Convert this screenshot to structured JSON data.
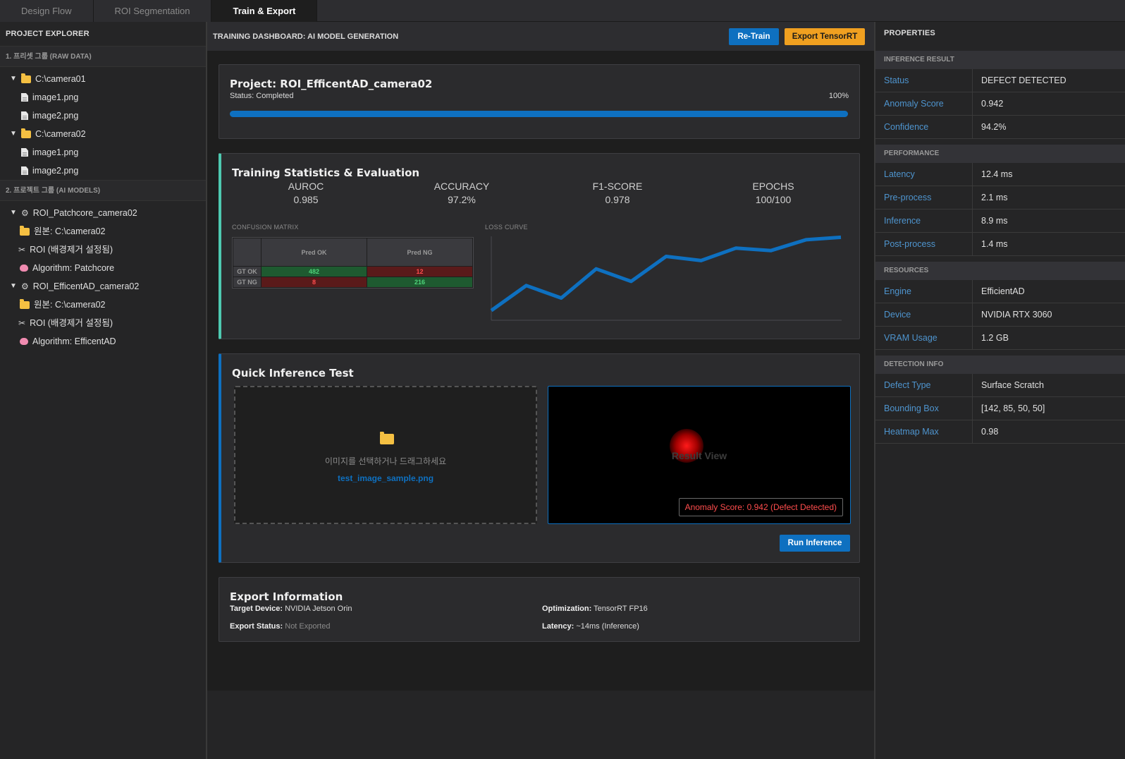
{
  "tabs": [
    {
      "label": "Design Flow"
    },
    {
      "label": "ROI Segmentation"
    },
    {
      "label": "Train & Export"
    }
  ],
  "explorer": {
    "title": "PROJECT EXPLORER",
    "group1": {
      "label": "1. 프리셋 그룹 (RAW DATA)",
      "folders": [
        {
          "name": "C:\\camera01",
          "files": [
            "image1.png",
            "image2.png"
          ]
        },
        {
          "name": "C:\\camera02",
          "files": [
            "image1.png",
            "image2.png"
          ]
        }
      ]
    },
    "group2": {
      "label": "2. 프로젝트 그룹 (AI MODELS)",
      "models": [
        {
          "name": "ROI_Patchcore_camera02",
          "source": "원본: C:\\camera02",
          "roi": "ROI (배경제거 설정됨)",
          "algorithm": "Algorithm: Patchcore"
        },
        {
          "name": "ROI_EfficentAD_camera02",
          "source": "원본: C:\\camera02",
          "roi": "ROI (배경제거 설정됨)",
          "algorithm": "Algorithm: EfficentAD"
        }
      ]
    }
  },
  "dashboard": {
    "title": "TRAINING DASHBOARD: AI MODEL GENERATION",
    "retrain_label": "Re-Train",
    "export_label": "Export TensorRT",
    "project": {
      "title": "Project: ROI_EfficentAD_camera02",
      "status": "Status: Completed",
      "progress_text": "100%",
      "progress": 1.0
    },
    "stats": {
      "title": "Training Statistics & Evaluation",
      "items": [
        {
          "label": "AUROC",
          "value": "0.985"
        },
        {
          "label": "ACCURACY",
          "value": "97.2%"
        },
        {
          "label": "F1-SCORE",
          "value": "0.978"
        },
        {
          "label": "EPOCHS",
          "value": "100/100"
        }
      ],
      "confusion_label": "CONFUSION MATRIX",
      "confusion": {
        "cols": [
          "Pred OK",
          "Pred NG"
        ],
        "rows": [
          {
            "label": "GT OK",
            "values": [
              "482",
              "12"
            ]
          },
          {
            "label": "GT NG",
            "values": [
              "8",
              "216"
            ]
          }
        ]
      },
      "loss_label": "LOSS CURVE"
    },
    "inference": {
      "title": "Quick Inference Test",
      "drop_text": "이미지를 선택하거나 드래그하세요",
      "file_name": "test_image_sample.png",
      "result_label": "Result View",
      "score_text": "Anomaly Score: 0.942 (Defect Detected)",
      "run_label": "Run Inference"
    },
    "export": {
      "title": "Export Information",
      "target_key": "Target Device:",
      "target_val": "NVIDIA Jetson Orin",
      "status_key": "Export Status:",
      "status_val": "Not Exported",
      "opt_key": "Optimization:",
      "opt_val": "TensorRT FP16",
      "latency_key": "Latency:",
      "latency_val": "~14ms (Inference)"
    }
  },
  "chart_data": {
    "type": "line",
    "title": "LOSS CURVE",
    "x": [
      1,
      2,
      3,
      4,
      5,
      6,
      7,
      8,
      9,
      10,
      11
    ],
    "values": [
      0.1,
      0.4,
      0.25,
      0.6,
      0.45,
      0.75,
      0.7,
      0.85,
      0.82,
      0.95,
      0.98
    ],
    "ylim": [
      0,
      1
    ],
    "color": "#0e70c0"
  },
  "properties": {
    "title": "PROPERTIES",
    "sections": [
      {
        "label": "INFERENCE RESULT",
        "rows": [
          {
            "key": "Status",
            "value": "DEFECT DETECTED"
          },
          {
            "key": "Anomaly Score",
            "value": "0.942"
          },
          {
            "key": "Confidence",
            "value": "94.2%"
          }
        ]
      },
      {
        "label": "PERFORMANCE",
        "rows": [
          {
            "key": "Latency",
            "value": "12.4 ms"
          },
          {
            "key": "Pre-process",
            "value": "2.1 ms"
          },
          {
            "key": "Inference",
            "value": "8.9 ms"
          },
          {
            "key": "Post-process",
            "value": "1.4 ms"
          }
        ]
      },
      {
        "label": "RESOURCES",
        "rows": [
          {
            "key": "Engine",
            "value": "EfficientAD"
          },
          {
            "key": "Device",
            "value": "NVIDIA RTX 3060"
          },
          {
            "key": "VRAM Usage",
            "value": "1.2 GB"
          }
        ]
      },
      {
        "label": "DETECTION INFO",
        "rows": [
          {
            "key": "Defect Type",
            "value": "Surface Scratch"
          },
          {
            "key": "Bounding Box",
            "value": "[142, 85, 50, 50]"
          },
          {
            "key": "Heatmap Max",
            "value": "0.98"
          }
        ]
      }
    ]
  },
  "colors": {
    "accent": "#0e70c0",
    "export": "#f0a020",
    "ok_cell": "#1e5a30",
    "ng_cell": "#5a1a1a",
    "ok_text": "#4ed47a",
    "ng_text": "#ff4d4d"
  }
}
